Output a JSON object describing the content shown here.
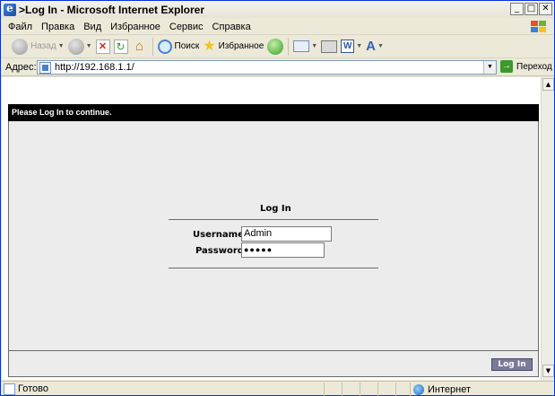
{
  "window": {
    "title": ">Log In - Microsoft Internet Explorer"
  },
  "menu": [
    "Файл",
    "Правка",
    "Вид",
    "Избранное",
    "Сервис",
    "Справка"
  ],
  "toolbar": {
    "back_label": "Назад",
    "search_label": "Поиск",
    "favorites_label": "Избранное"
  },
  "address": {
    "label": "Адрес:",
    "url": "http://192.168.1.1/",
    "go_label": "Переход"
  },
  "page": {
    "banner": "Please Log In to continue.",
    "form_title": "Log In",
    "username_label": "Username:",
    "username_value": "Admin",
    "password_label": "Password:",
    "password_value": "●●●●●",
    "login_button": "Log In"
  },
  "status": {
    "text": "Готово",
    "zone": "Интернет"
  },
  "colors": {
    "banner_bg": "#000000",
    "panel_bg": "#ececec",
    "button_bg": "#7a7a9a"
  }
}
